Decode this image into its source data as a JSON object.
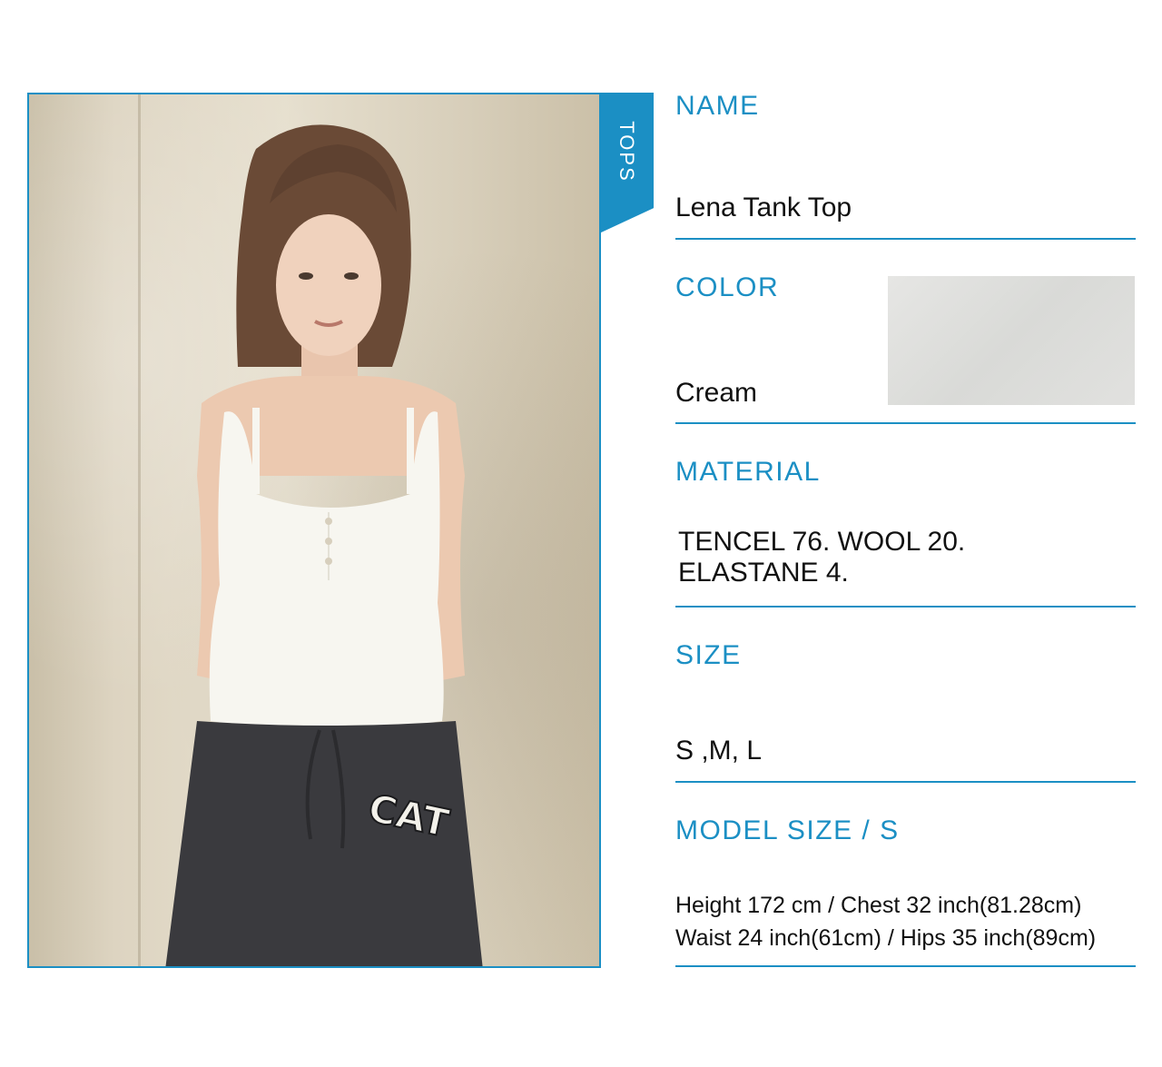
{
  "category_tab": "TOPS",
  "product": {
    "name_label": "NAME",
    "name": "Lena Tank Top",
    "color_label": "COLOR",
    "color": "Cream",
    "swatch_color": "#dededb",
    "material_label": "MATERIAL",
    "material_line1": "TENCEL 76.  WOOL 20.",
    "material_line2": "ELASTANE 4.",
    "size_label": "SIZE",
    "sizes": "S ,M, L",
    "model_label": "MODEL SIZE / S",
    "model_line1": "Height 172 cm / Chest 32 inch(81.28cm)",
    "model_line2": "Waist 24 inch(61cm) / Hips 35 inch(89cm)"
  },
  "photo": {
    "pants_print": "CAT"
  },
  "colors": {
    "accent": "#1b8fc4"
  }
}
